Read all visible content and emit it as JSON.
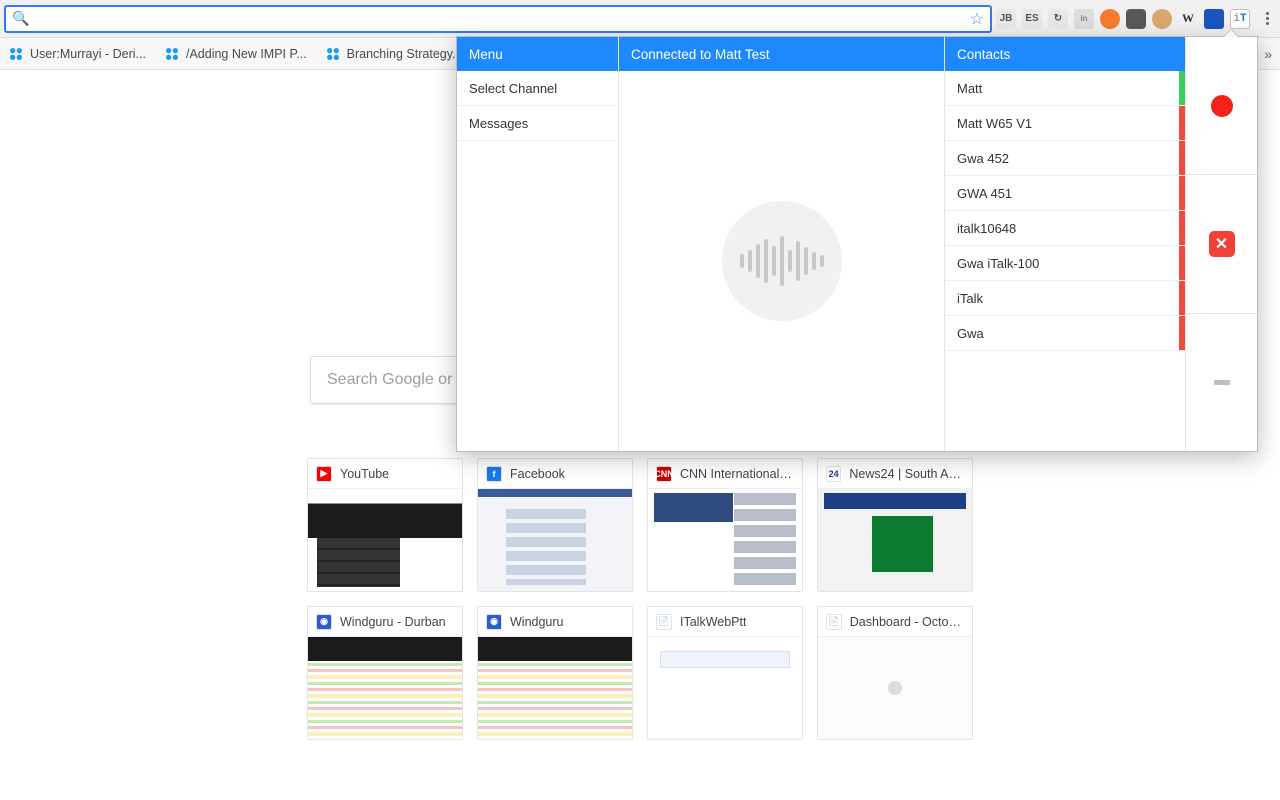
{
  "omnibox": {
    "value": "",
    "placeholder": ""
  },
  "bookmarks": [
    {
      "label": "User:Murrayi - Deri..."
    },
    {
      "label": "/Adding New IMPI P..."
    },
    {
      "label": "Branching Strategy..."
    }
  ],
  "extension_icons": [
    {
      "name": "jb-icon",
      "label": "JB",
      "cls": "plain"
    },
    {
      "name": "es-icon",
      "label": "ES",
      "cls": "plain"
    },
    {
      "name": "refresh-icon",
      "label": "↻",
      "cls": "plain"
    },
    {
      "name": "in-icon",
      "label": "In",
      "cls": "inlined"
    },
    {
      "name": "orange-icon",
      "label": "",
      "cls": "orange"
    },
    {
      "name": "darkgray-icon",
      "label": "",
      "cls": "darkgray"
    },
    {
      "name": "fox-icon",
      "label": "",
      "cls": "tan"
    },
    {
      "name": "w-icon",
      "label": "W",
      "cls": "w"
    },
    {
      "name": "blue-icon",
      "label": "",
      "cls": "blue"
    },
    {
      "name": "it-icon",
      "label": "iT",
      "cls": "it"
    }
  ],
  "ntp": {
    "search_placeholder": "Search Google or type URL",
    "tiles": [
      {
        "label": "YouTube",
        "fav_bg": "#ff0000",
        "fav_txt": "▶",
        "thumb": "youtube"
      },
      {
        "label": "Facebook",
        "fav_bg": "#1877f2",
        "fav_txt": "f",
        "thumb": "facebook"
      },
      {
        "label": "CNN International - ...",
        "fav_bg": "#cc0000",
        "fav_txt": "CNN",
        "thumb": "cnn"
      },
      {
        "label": "News24 | South Afri...",
        "fav_bg": "#ffffff",
        "fav_txt": "24",
        "fav_color": "#1f3e88",
        "thumb": "news24"
      },
      {
        "label": "Windguru - Durban",
        "fav_bg": "#2a5ad4",
        "fav_txt": "◉",
        "thumb": "windguru"
      },
      {
        "label": "Windguru",
        "fav_bg": "#2a5ad4",
        "fav_txt": "◉",
        "thumb": "windguru"
      },
      {
        "label": "ITalkWebPtt",
        "fav_bg": "#ffffff",
        "fav_txt": "📄",
        "fav_color": "#888",
        "thumb": "italk"
      },
      {
        "label": "Dashboard - Octop...",
        "fav_bg": "#ffffff",
        "fav_txt": "📄",
        "fav_color": "#888",
        "thumb": "dashboard"
      }
    ]
  },
  "popup": {
    "menu_header": "Menu",
    "center_header": "Connected to Matt Test",
    "contacts_header": "Contacts",
    "menu_items": [
      {
        "label": "Select Channel"
      },
      {
        "label": "Messages"
      }
    ],
    "contacts": [
      {
        "label": "Matt",
        "status": "green"
      },
      {
        "label": "Matt W65 V1",
        "status": "red"
      },
      {
        "label": "Gwa 452",
        "status": "red"
      },
      {
        "label": "GWA 451",
        "status": "red"
      },
      {
        "label": "italk10648",
        "status": "red"
      },
      {
        "label": "Gwa iTalk-100",
        "status": "red"
      },
      {
        "label": "iTalk",
        "status": "red"
      },
      {
        "label": "Gwa",
        "status": "red"
      }
    ],
    "wave_bars": [
      14,
      22,
      34,
      44,
      30,
      50,
      22,
      40,
      28,
      18,
      12
    ]
  }
}
